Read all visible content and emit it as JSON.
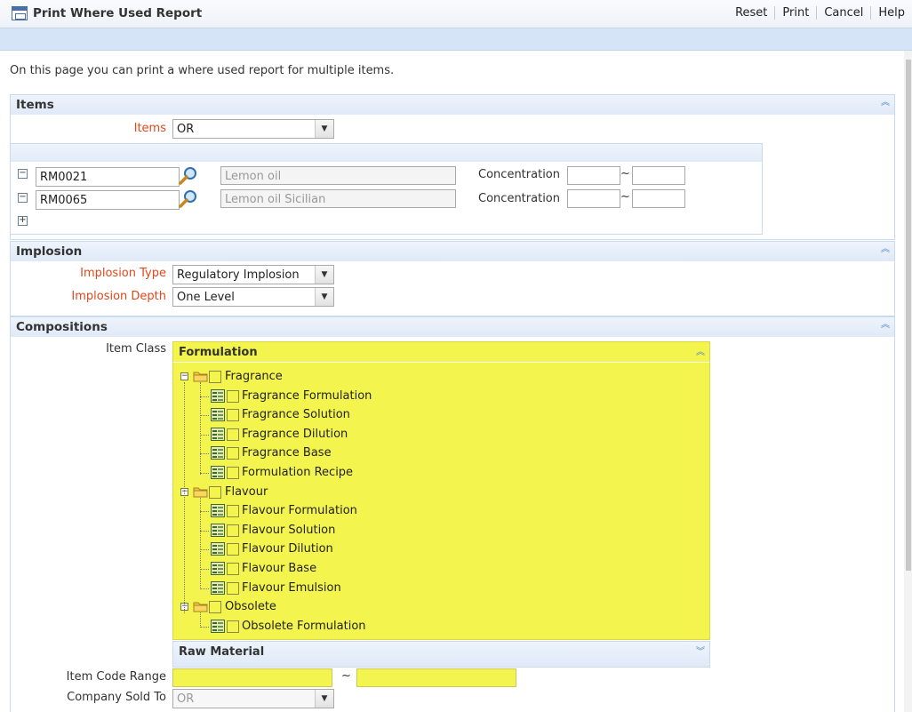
{
  "window": {
    "title": "Print Where Used Report"
  },
  "toolbar": {
    "reset": "Reset",
    "print": "Print",
    "cancel": "Cancel",
    "help": "Help"
  },
  "intro": "On this page you can print a where used report for multiple items.",
  "items_section": {
    "title": "Items",
    "items_label": "Items",
    "items_value": "OR",
    "rows": [
      {
        "code": "RM0021",
        "description": "Lemon oil",
        "concentration_label": "Concentration",
        "from": "",
        "to": "",
        "sep": "~"
      },
      {
        "code": "RM0065",
        "description": "Lemon oil Sicilian",
        "concentration_label": "Concentration",
        "from": "",
        "to": "",
        "sep": "~"
      }
    ]
  },
  "implosion_section": {
    "title": "Implosion",
    "type_label": "Implosion Type",
    "type_value": "Regulatory Implosion",
    "depth_label": "Implosion Depth",
    "depth_value": "One Level"
  },
  "compositions_section": {
    "title": "Compositions",
    "item_class_label": "Item Class",
    "formulation_title": "Formulation",
    "groups": [
      {
        "label": "Fragrance",
        "children": [
          "Fragrance Formulation",
          "Fragrance Solution",
          "Fragrance Dilution",
          "Fragrance Base",
          "Formulation Recipe"
        ]
      },
      {
        "label": "Flavour",
        "children": [
          "Flavour Formulation",
          "Flavour Solution",
          "Flavour Dilution",
          "Flavour Base",
          "Flavour Emulsion"
        ]
      },
      {
        "label": "Obsolete",
        "children": [
          "Obsolete Formulation"
        ]
      }
    ],
    "raw_material_title": "Raw Material",
    "item_code_range_label": "Item Code Range",
    "item_code_from": "",
    "item_code_to": "",
    "range_sep": "~",
    "company_sold_to_label": "Company Sold To",
    "company_sold_to_value": "OR"
  },
  "colors": {
    "accent": "#4b87c9",
    "required_label": "#e0481c",
    "highlight": "#f4f44e",
    "header_bg": "#d5e4f6"
  }
}
